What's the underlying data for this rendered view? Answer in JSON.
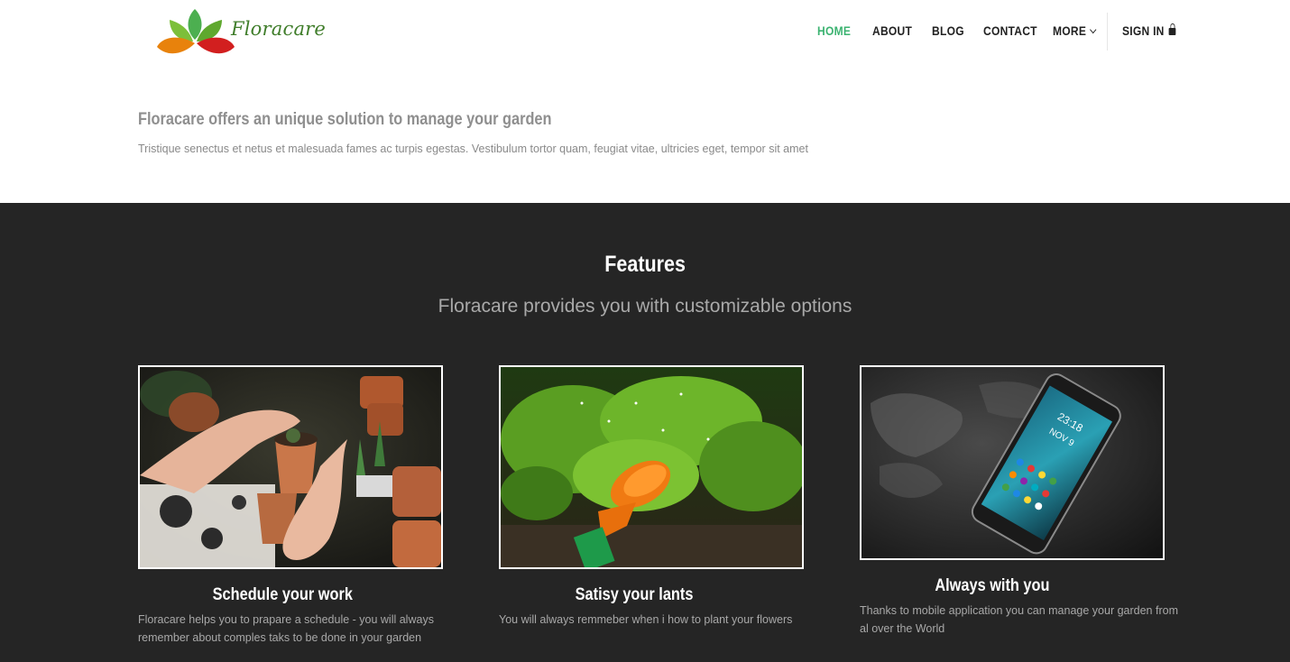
{
  "brand": {
    "name": "Floracare",
    "logo_colors": {
      "green": "#4caf50",
      "orange": "#e8820c",
      "red": "#d21f1f"
    }
  },
  "nav": {
    "items": [
      {
        "label": "HOME",
        "active": true
      },
      {
        "label": "ABOUT",
        "active": false
      },
      {
        "label": "BLOG",
        "active": false
      },
      {
        "label": "CONTACT",
        "active": false
      },
      {
        "label": "MORE",
        "active": false,
        "icon": "chevron-down-icon"
      }
    ],
    "signin": {
      "label": "SIGN IN",
      "icon": "lock-icon"
    },
    "active_color": "#3cb371"
  },
  "intro": {
    "title": "Floracare offers an unique solution to manage your garden",
    "text": "Tristique senectus et netus et malesuada fames ac turpis egestas. Vestibulum tortor quam, feugiat vitae, ultricies eget, tempor sit amet"
  },
  "features": {
    "title": "Features",
    "subtitle": "Floracare provides you with customizable options",
    "background": "#252525",
    "cards": [
      {
        "title": "Schedule your work",
        "text": "Floracare helps you to prapare a schedule - you will always remember about comples taks to be done in your garden",
        "image": "hands-potting-plant-photo"
      },
      {
        "title": "Satisy your lants",
        "text": "You will always remmeber when i how to plant your flowers",
        "image": "watering-can-plants-photo"
      },
      {
        "title": "Always with you",
        "text": "Thanks to mobile application you can manage your garden from al over the World",
        "image": "smartphone-on-map-photo",
        "phone_time": "23:18",
        "phone_date": "NOV 9"
      }
    ]
  }
}
